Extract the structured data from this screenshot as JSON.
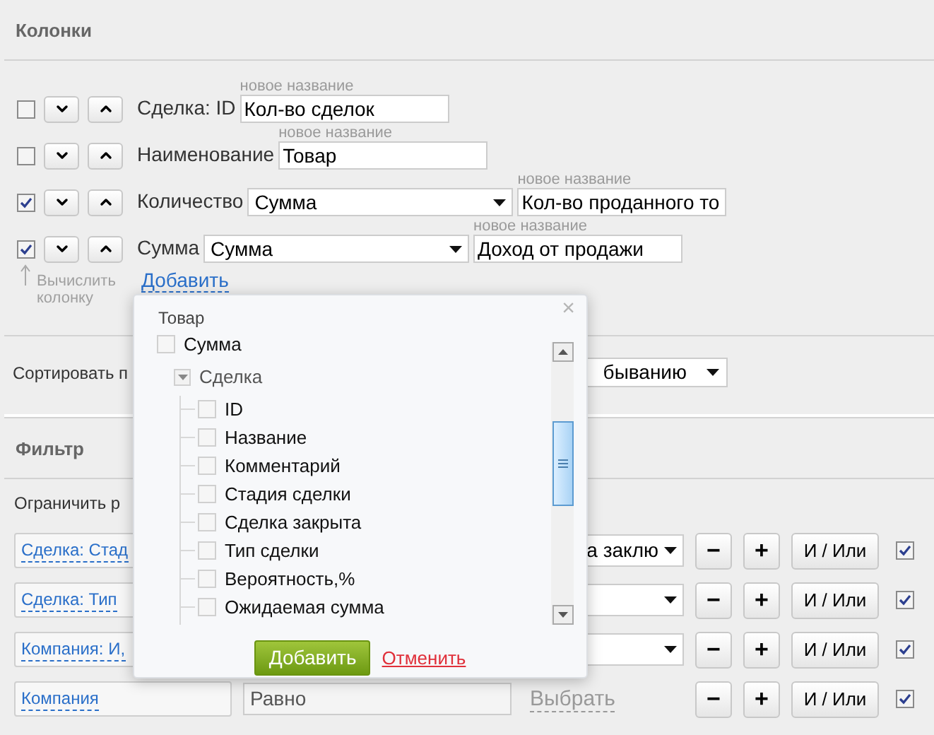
{
  "columns_section": {
    "title": "Колонки",
    "rows": [
      {
        "checked": false,
        "label": "Сделка: ID",
        "new_name_label": "новое название",
        "value": "Кол-во сделок"
      },
      {
        "checked": false,
        "label": "Наименование",
        "new_name_label": "новое название",
        "value": "Товар"
      },
      {
        "checked": true,
        "label": "Количество",
        "function": "Сумма",
        "new_name_label": "новое название",
        "value": "Кол-во проданного то"
      },
      {
        "checked": true,
        "label": "Сумма",
        "function": "Сумма",
        "new_name_label": "новое название",
        "value": "Доход от продажи"
      }
    ],
    "hint": "Вычислить колонку",
    "add_link": "Добавить"
  },
  "sort": {
    "label": "Сортировать п",
    "select": "быванию"
  },
  "filter_section": {
    "title": "Фильтр",
    "limit_label": "Ограничить р",
    "rows": [
      {
        "field": "Сделка: Стад",
        "value": {
          "kind": "select",
          "text": "а заклю"
        },
        "minus": "−",
        "plus": "+",
        "logic": "И / Или",
        "checked": true
      },
      {
        "field": "Сделка: Тип",
        "value": {
          "kind": "select"
        },
        "minus": "−",
        "plus": "+",
        "logic": "И / Или",
        "checked": true
      },
      {
        "field": "Компания: И,",
        "value": {
          "kind": "select"
        },
        "minus": "−",
        "plus": "+",
        "logic": "И / Или",
        "checked": true
      },
      {
        "field": "Компания",
        "operator": "Равно",
        "value": {
          "kind": "link",
          "text": "Выбрать"
        },
        "minus": "−",
        "plus": "+",
        "logic": "И / Или",
        "checked": true
      }
    ]
  },
  "popup": {
    "title": "Товар",
    "close": "×",
    "items": [
      {
        "label": "Сумма",
        "checked": false
      },
      {
        "label": "Сделка",
        "expanded": true,
        "children": [
          {
            "label": "ID",
            "checked": false
          },
          {
            "label": "Название",
            "checked": false
          },
          {
            "label": "Комментарий",
            "checked": false
          },
          {
            "label": "Стадия сделки",
            "checked": false
          },
          {
            "label": "Сделка закрыта",
            "checked": false
          },
          {
            "label": "Тип сделки",
            "checked": false
          },
          {
            "label": "Вероятность,%",
            "checked": false
          },
          {
            "label": "Ожидаемая сумма",
            "checked": false
          }
        ]
      }
    ],
    "add_button": "Добавить",
    "cancel_link": "Отменить"
  }
}
